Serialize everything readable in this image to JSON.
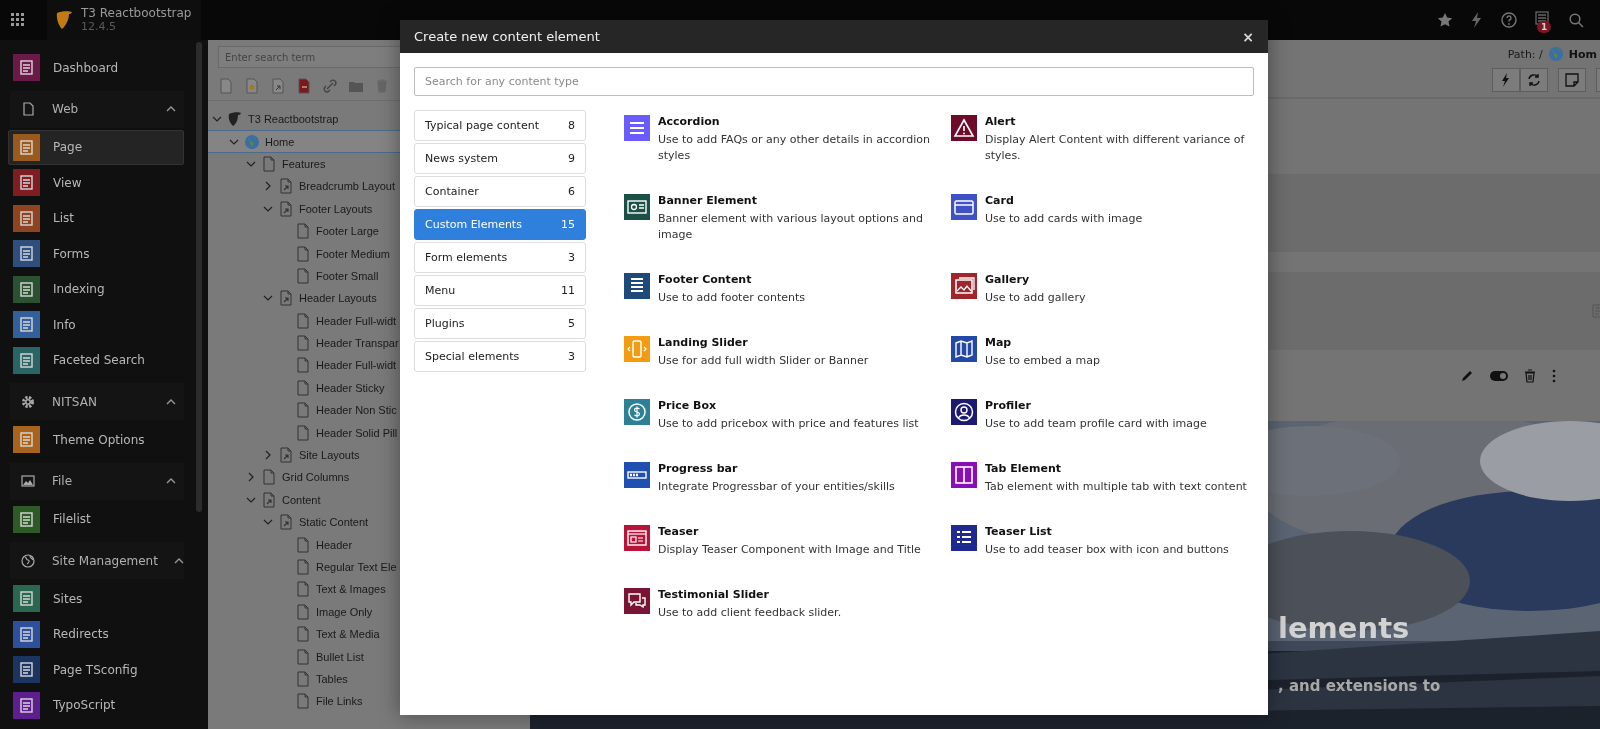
{
  "topbar": {
    "site_name": "T3 Reactbootstrap",
    "version": "12.4.5",
    "notification_count": "1"
  },
  "sidebar": [
    {
      "kind": "module",
      "label": "Dashboard",
      "color": "#6b1a48",
      "selected": false
    },
    {
      "kind": "section",
      "label": "Web",
      "expanded": true
    },
    {
      "kind": "module",
      "label": "Page",
      "color": "#9a5a1e",
      "selected": true
    },
    {
      "kind": "module",
      "label": "View",
      "color": "#7e1e22",
      "selected": false
    },
    {
      "kind": "module",
      "label": "List",
      "color": "#8e4420",
      "selected": false
    },
    {
      "kind": "module",
      "label": "Forms",
      "color": "#2e4f7e",
      "selected": false
    },
    {
      "kind": "module",
      "label": "Indexing",
      "color": "#2a5230",
      "selected": false
    },
    {
      "kind": "module",
      "label": "Info",
      "color": "#33609a",
      "selected": false
    },
    {
      "kind": "module",
      "label": "Faceted Search",
      "color": "#2a6464",
      "selected": false
    },
    {
      "kind": "section",
      "label": "NITSAN",
      "expanded": true
    },
    {
      "kind": "module",
      "label": "Theme Options",
      "color": "#a8641c",
      "selected": false
    },
    {
      "kind": "section",
      "label": "File",
      "expanded": true
    },
    {
      "kind": "module",
      "label": "Filelist",
      "color": "#2e5a28",
      "selected": false
    },
    {
      "kind": "section",
      "label": "Site Management",
      "expanded": true
    },
    {
      "kind": "module",
      "label": "Sites",
      "color": "#2a6650",
      "selected": false
    },
    {
      "kind": "module",
      "label": "Redirects",
      "color": "#2d4f9c",
      "selected": false
    },
    {
      "kind": "module",
      "label": "Page TSconfig",
      "color": "#1c3560",
      "selected": false
    },
    {
      "kind": "module",
      "label": "TypoScript",
      "color": "#5e1f8e",
      "selected": false
    }
  ],
  "page_tree": {
    "search": {
      "placeholder": "Enter search term"
    },
    "items": [
      {
        "kind": "root",
        "label": "T3 Reactbootstrap",
        "expanded": true,
        "selected": false,
        "children": [
          {
            "kind": "site",
            "label": "Home",
            "expanded": true,
            "selected": true,
            "children": [
              {
                "kind": "page",
                "label": "Features",
                "expanded": true,
                "selected": false,
                "children": [
                  {
                    "kind": "shortcut",
                    "label": "Breadcrumb Layout",
                    "expanded": false,
                    "selected": false
                  },
                  {
                    "kind": "shortcut",
                    "label": "Footer Layouts",
                    "expanded": true,
                    "selected": false,
                    "children": [
                      {
                        "kind": "page",
                        "label": "Footer Large",
                        "selected": false
                      },
                      {
                        "kind": "page",
                        "label": "Footer Medium",
                        "selected": false
                      },
                      {
                        "kind": "page",
                        "label": "Footer Small",
                        "selected": false
                      }
                    ]
                  },
                  {
                    "kind": "shortcut",
                    "label": "Header Layouts",
                    "expanded": true,
                    "selected": false,
                    "children": [
                      {
                        "kind": "page",
                        "label": "Header Full-widt",
                        "selected": false
                      },
                      {
                        "kind": "page",
                        "label": "Header Transpar",
                        "selected": false
                      },
                      {
                        "kind": "page",
                        "label": "Header Full-widt",
                        "selected": false
                      },
                      {
                        "kind": "page",
                        "label": "Header Sticky",
                        "selected": false
                      },
                      {
                        "kind": "page",
                        "label": "Header Non Stic",
                        "selected": false
                      },
                      {
                        "kind": "page",
                        "label": "Header Solid Pill",
                        "selected": false
                      }
                    ]
                  },
                  {
                    "kind": "shortcut",
                    "label": "Site Layouts",
                    "expanded": false,
                    "selected": false
                  }
                ]
              },
              {
                "kind": "page",
                "label": "Grid Columns",
                "expanded": false,
                "selected": false
              },
              {
                "kind": "shortcut",
                "label": "Content",
                "expanded": true,
                "selected": false,
                "children": [
                  {
                    "kind": "shortcut",
                    "label": "Static Content",
                    "expanded": true,
                    "selected": false,
                    "children": [
                      {
                        "kind": "page",
                        "label": "Header",
                        "selected": false
                      },
                      {
                        "kind": "page",
                        "label": "Regular Text Ele",
                        "selected": false
                      },
                      {
                        "kind": "page",
                        "label": "Text & Images",
                        "selected": false
                      },
                      {
                        "kind": "page",
                        "label": "Image Only",
                        "selected": false
                      },
                      {
                        "kind": "page",
                        "label": "Text & Media",
                        "selected": false
                      },
                      {
                        "kind": "page",
                        "label": "Bullet List",
                        "selected": false
                      },
                      {
                        "kind": "page",
                        "label": "Tables",
                        "selected": false
                      },
                      {
                        "kind": "page",
                        "label": "File Links",
                        "selected": false
                      }
                    ]
                  }
                ]
              }
            ]
          }
        ]
      }
    ]
  },
  "content": {
    "path_label": "Path: /",
    "path_page": "Hom",
    "banner_heading": "lements",
    "banner_text": ", and extensions to"
  },
  "modal": {
    "title": "Create new content element",
    "close": "×",
    "search": {
      "placeholder": "Search for any content type"
    },
    "categories": [
      {
        "label": "Typical page content",
        "count": "8",
        "selected": false
      },
      {
        "label": "News system",
        "count": "9",
        "selected": false
      },
      {
        "label": "Container",
        "count": "6",
        "selected": false
      },
      {
        "label": "Custom Elements",
        "count": "15",
        "selected": true
      },
      {
        "label": "Form elements",
        "count": "3",
        "selected": false
      },
      {
        "label": "Menu",
        "count": "11",
        "selected": false
      },
      {
        "label": "Plugins",
        "count": "5",
        "selected": false
      },
      {
        "label": "Special elements",
        "count": "3",
        "selected": false
      }
    ],
    "elements": [
      {
        "title": "Accordion",
        "description": "Use to add FAQs or any other details in accordion styles",
        "color": "#6a5cff"
      },
      {
        "title": "Alert",
        "description": "Display Alert Content with different variance of styles.",
        "color": "#6e0a2a"
      },
      {
        "title": "Banner Element",
        "description": "Banner element with various layout options and image",
        "color": "#1b5049"
      },
      {
        "title": "Card",
        "description": "Use to add cards with image",
        "color": "#3f51c5"
      },
      {
        "title": "Footer Content",
        "description": "Use to add footer contents",
        "color": "#1d4a7a"
      },
      {
        "title": "Gallery",
        "description": "Use to add gallery",
        "color": "#a0262e"
      },
      {
        "title": "Landing Slider",
        "description": "Use for add full width Slider or Banner",
        "color": "#f39c12"
      },
      {
        "title": "Map",
        "description": "Use to embed a map",
        "color": "#2348a8"
      },
      {
        "title": "Price Box",
        "description": "Use to add pricebox with price and features list",
        "color": "#2c8197"
      },
      {
        "title": "Profiler",
        "description": "Use to add team profile card with image",
        "color": "#1e1970"
      },
      {
        "title": "Progress bar",
        "description": "Integrate Progressbar of your entities/skills",
        "color": "#1f4fb0"
      },
      {
        "title": "Tab Element",
        "description": "Tab element with multiple tab with text content",
        "color": "#8a0eb8"
      },
      {
        "title": "Teaser",
        "description": "Display Teaser Component with Image and Title",
        "color": "#b8143a"
      },
      {
        "title": "Teaser List",
        "description": "Use to add teaser box with icon and buttons",
        "color": "#1f2a90"
      },
      {
        "title": "Testimonial Slider",
        "description": "Use to add client feedback slider.",
        "color": "#7a1434"
      }
    ]
  }
}
